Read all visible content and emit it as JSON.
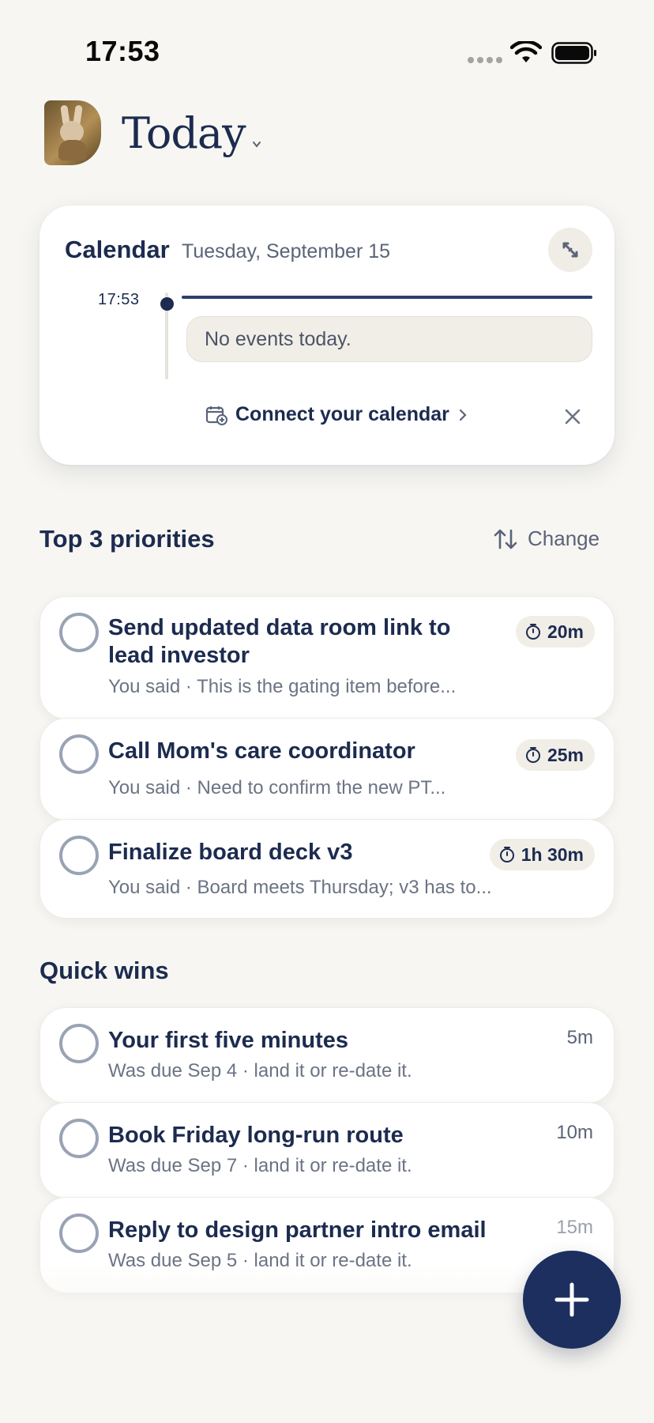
{
  "status_bar": {
    "time": "17:53"
  },
  "header": {
    "title": "Today",
    "avatar_icon": "bunny-avatar-icon"
  },
  "calendar": {
    "title": "Calendar",
    "date": "Tuesday, September 15",
    "now_time": "17:53",
    "empty_text": "No events today.",
    "connect_label": "Connect your calendar"
  },
  "priorities": {
    "title": "Top 3 priorities",
    "change_label": "Change",
    "items": [
      {
        "title": "Send updated data room link to",
        "title2": "lead investor",
        "subtitle": "You said · This is the gating item before...",
        "duration": "20m"
      },
      {
        "title": "Call Mom's care coordinator",
        "subtitle": "You said · Need to confirm the new PT...",
        "duration": "25m"
      },
      {
        "title": "Finalize board deck v3",
        "subtitle": "You said · Board meets Thursday; v3 has to...",
        "duration": "1h 30m"
      }
    ]
  },
  "quick_wins": {
    "title": "Quick wins",
    "items": [
      {
        "title": "Your first five minutes",
        "subtitle": "Was due Sep 4 · land it or re-date it.",
        "duration": "5m"
      },
      {
        "title": "Book Friday long-run route",
        "subtitle": "Was due Sep 7 · land it or re-date it.",
        "duration": "10m"
      },
      {
        "title": "Reply to design partner intro email",
        "subtitle": "Was due Sep 5 · land it or re-date it.",
        "duration": "15m"
      }
    ]
  },
  "colors": {
    "accent": "#1c2f5f",
    "background": "#f7f6f2",
    "text": "#1c2b4f"
  }
}
